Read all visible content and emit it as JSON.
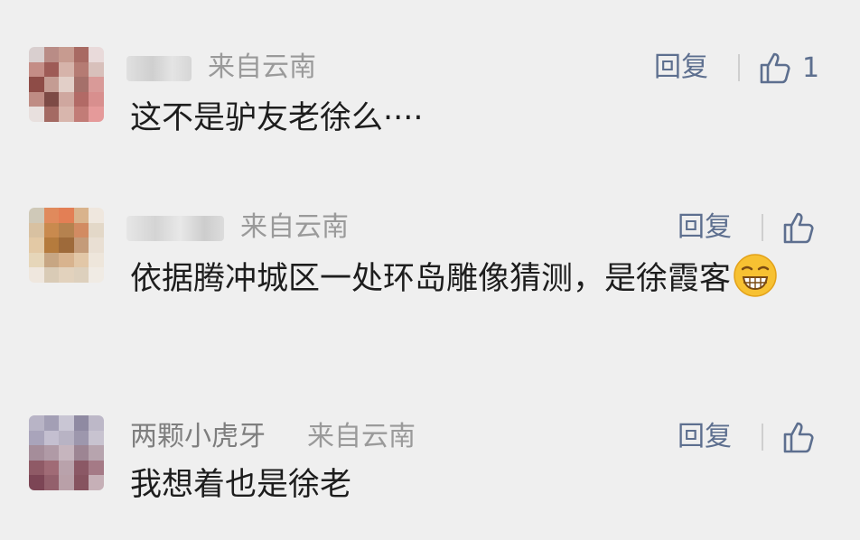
{
  "comments": [
    {
      "name": "",
      "location": "来自云南",
      "text": "这不是驴友老徐么····",
      "reply_label": "回复",
      "likes": "1",
      "avatar_colors": [
        "#d9cfcf",
        "#b98c86",
        "#c79b90",
        "#a86a63",
        "#e9dada",
        "#c48d86",
        "#9e5b56",
        "#d6b3aa",
        "#b57b73",
        "#d8c0bb",
        "#8e4c47",
        "#c49c93",
        "#e2cfc8",
        "#a5706a",
        "#d99a98",
        "#bf8c84",
        "#7d4a45",
        "#cfa79f",
        "#b26a66",
        "#d88f8e",
        "#e8e0de",
        "#a46a63",
        "#d8b6ad",
        "#c27c77",
        "#e59a9a"
      ]
    },
    {
      "name": "",
      "location": "来自云南",
      "text": "依据腾冲城区一处环岛雕像猜测，是徐霞客",
      "emoji": "grinning-emoji",
      "reply_label": "回复",
      "likes": "",
      "avatar_colors": [
        "#cfc9b8",
        "#e08a5c",
        "#e37f55",
        "#d9b38c",
        "#efe7de",
        "#d8c1a1",
        "#c98a4e",
        "#b5824f",
        "#d28b62",
        "#e3d8c8",
        "#e3c9a5",
        "#b57b3d",
        "#9e6a3a",
        "#c49b79",
        "#e9dfd3",
        "#e6d6b9",
        "#c7a683",
        "#d8b38e",
        "#e2c7a7",
        "#eee6db",
        "#efe7de",
        "#d9cbb6",
        "#e2d2bd",
        "#ddd0bd",
        "#f0ebe4"
      ]
    },
    {
      "name": "两颗小虎牙",
      "location": "来自云南",
      "text": "我想着也是徐老",
      "reply_label": "回复",
      "likes": "",
      "avatar_colors": [
        "#b8b4c6",
        "#a39fb5",
        "#c9c6d4",
        "#8f8aa2",
        "#bdb8c8",
        "#a9a4bb",
        "#c4bfd0",
        "#b8b3c4",
        "#9d97ad",
        "#c8c3d0",
        "#a58d9a",
        "#b09aa6",
        "#c6b5be",
        "#9d8593",
        "#b7a4ae",
        "#8f5a66",
        "#a06b76",
        "#b9a2ab",
        "#8b5865",
        "#a57a86",
        "#7c4555",
        "#93606c",
        "#b9a0a8",
        "#86535f",
        "#c6b0b7"
      ]
    }
  ]
}
